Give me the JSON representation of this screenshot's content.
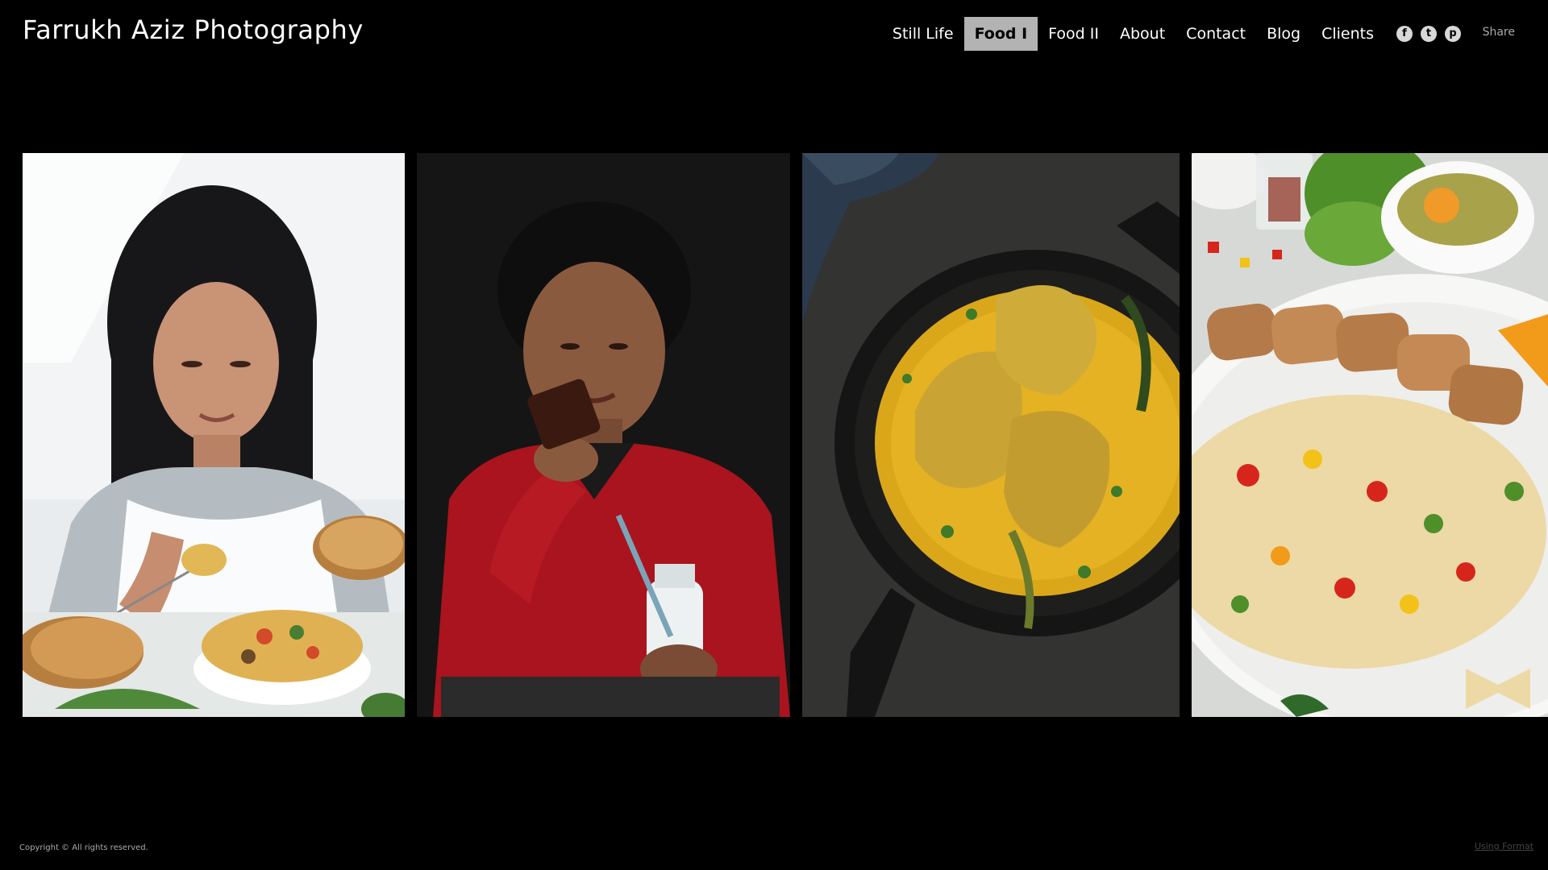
{
  "site": {
    "title": "Farrukh Aziz Photography"
  },
  "nav": {
    "items": [
      {
        "label": "Still Life"
      },
      {
        "label": "Food I"
      },
      {
        "label": "Food II"
      },
      {
        "label": "About"
      },
      {
        "label": "Contact"
      },
      {
        "label": "Blog"
      },
      {
        "label": "Clients"
      }
    ],
    "active_item": "Food I"
  },
  "social": {
    "icons": [
      {
        "name": "facebook-icon",
        "glyph": "f"
      },
      {
        "name": "twitter-icon",
        "glyph": "t"
      },
      {
        "name": "pinterest-icon",
        "glyph": "p"
      }
    ],
    "share_label": "Share"
  },
  "gallery": {
    "photos": [
      {
        "subject": "girl-eating-pasta"
      },
      {
        "subject": "boy-eating-cake"
      },
      {
        "subject": "fish-curry-skillet"
      },
      {
        "subject": "chicken-pasta-salad"
      }
    ]
  },
  "footer": {
    "copyright": "Copyright © All rights reserved.",
    "using_format": "Using Format"
  },
  "colors": {
    "background": "#000000",
    "active_nav_bg": "#b3b3b3",
    "text": "#ffffff"
  }
}
